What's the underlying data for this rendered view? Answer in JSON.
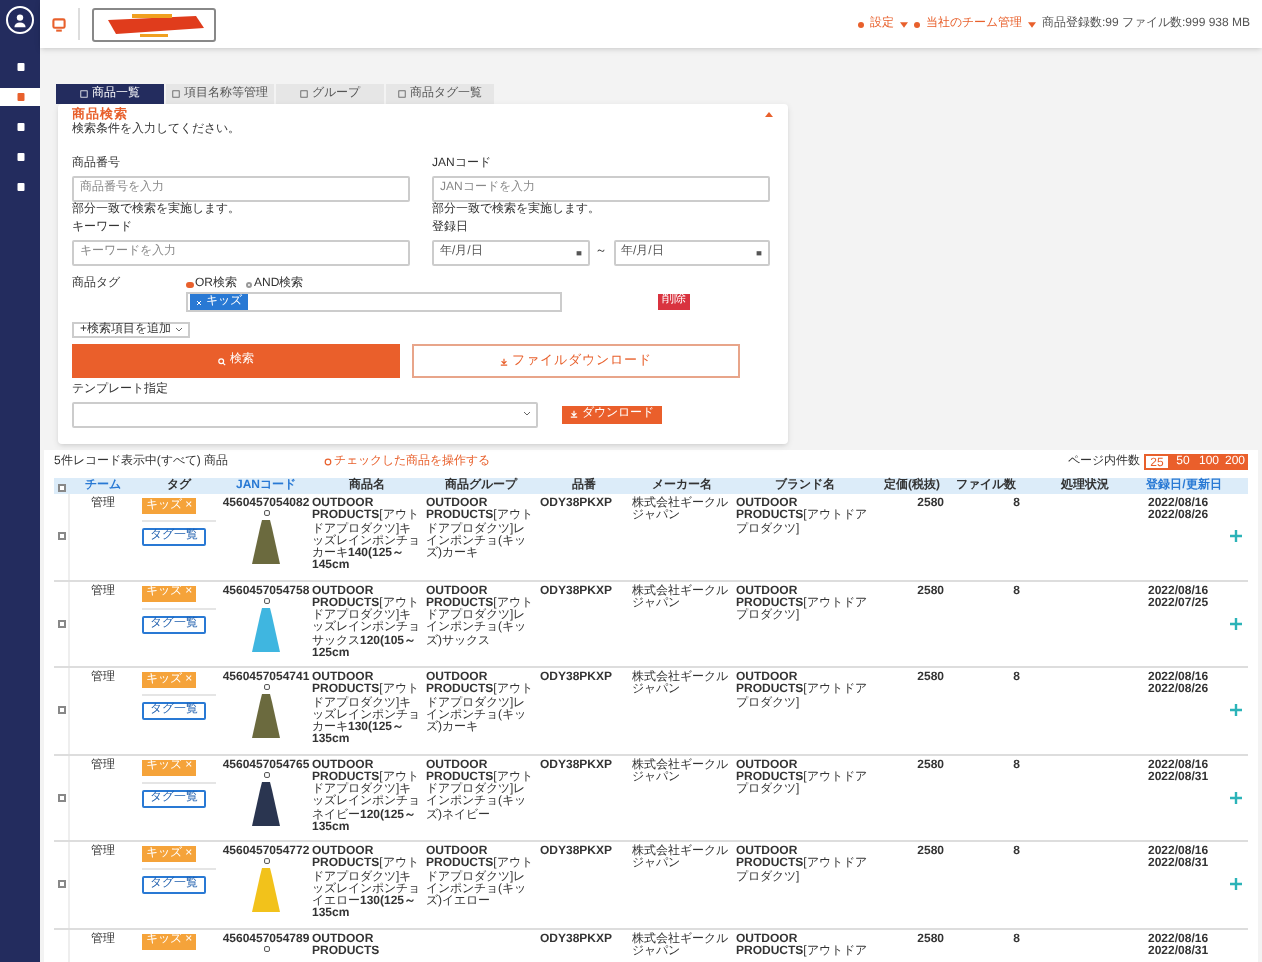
{
  "sidebar": {
    "items": [
      {
        "selected": false
      },
      {
        "selected": true
      },
      {
        "selected": false
      },
      {
        "selected": false
      },
      {
        "selected": false
      }
    ]
  },
  "header": {
    "settings": "設定",
    "team": "当社のチーム管理",
    "stats": "商品登録数:99 ファイル数:999 938 MB"
  },
  "tabs": [
    {
      "label": "商品一覧",
      "selected": true
    },
    {
      "label": "項目名称等管理",
      "selected": false
    },
    {
      "label": "グループ",
      "selected": false
    },
    {
      "label": "商品タグ一覧",
      "selected": false
    }
  ],
  "search": {
    "title": "商品検索",
    "subtitle": "検索条件を入力してください。",
    "product_no": {
      "label": "商品番号",
      "placeholder": "商品番号を入力",
      "hint": "部分一致で検索を実施します。"
    },
    "jan": {
      "label": "JANコード",
      "placeholder": "JANコードを入力",
      "hint": "部分一致で検索を実施します。"
    },
    "keyword": {
      "label": "キーワード",
      "placeholder": "キーワードを入力"
    },
    "date": {
      "label": "登録日",
      "from": "年/月/日",
      "separator": "～",
      "to": "年/月/日"
    },
    "tag": {
      "label": "商品タグ",
      "modes": [
        {
          "label": "OR検索",
          "selected": true
        },
        {
          "label": "AND検索",
          "selected": false
        }
      ],
      "chips": [
        "キッズ"
      ],
      "delete": "削除"
    },
    "add_condition": "+検索項目を追加",
    "search_button": "検索",
    "file_download": "ファイルダウンロード",
    "template_label": "テンプレート指定",
    "download_button": "ダウンロード"
  },
  "results": {
    "count": "5件レコード表示中(すべて) 商品",
    "bulk_action": "チェックした商品を操作する",
    "page_size_label": "ページ内件数",
    "page_sizes": [
      {
        "label": "25",
        "selected": true
      },
      {
        "label": "50",
        "selected": false
      },
      {
        "label": "100",
        "selected": false
      },
      {
        "label": "200",
        "selected": false
      }
    ]
  },
  "table": {
    "select_all_checked": false,
    "columns": [
      "チーム",
      "タグ",
      "JANコード",
      "商品名",
      "商品グループ",
      "品番",
      "メーカー名",
      "ブランド名",
      "定価(税抜)",
      "ファイル数",
      "処理状況",
      "登録日/更新日"
    ],
    "rows": [
      {
        "checked": false,
        "team": "管理",
        "tag": "キッズ ×",
        "tag_list": "タグ一覧",
        "jan": "4560457054082",
        "color": "#6b6a3e",
        "name": "**OUTDOOR PRODUCTS**[アウトドアプロダクツ]キッズレインポンチョカーキ**140(125～145cm**",
        "group": "**OUTDOOR PRODUCTS**[アウトドアプロダクツ]レインポンチョ(キッズ)カーキ",
        "part_no": "ODY38PKXP",
        "maker": "株式会社ギークルジャパン",
        "brand": "**OUTDOOR PRODUCTS**[アウトドアプロダクツ]",
        "price": "2580",
        "files": "8",
        "registered": "2022/08/16",
        "updated": "2022/08/26"
      },
      {
        "checked": false,
        "team": "管理",
        "tag": "キッズ ×",
        "tag_list": "タグ一覧",
        "jan": "4560457054758",
        "color": "#3fb6e0",
        "name": "**OUTDOOR PRODUCTS**[アウトドアプロダクツ]キッズレインポンチョサックス**120(105～125cm**",
        "group": "**OUTDOOR PRODUCTS**[アウトドアプロダクツ]レインポンチョ(キッズ)サックス",
        "part_no": "ODY38PKXP",
        "maker": "株式会社ギークルジャパン",
        "brand": "**OUTDOOR PRODUCTS**[アウトドアプロダクツ]",
        "price": "2580",
        "files": "8",
        "registered": "2022/08/16",
        "updated": "2022/07/25"
      },
      {
        "checked": false,
        "team": "管理",
        "tag": "キッズ ×",
        "tag_list": "タグ一覧",
        "jan": "4560457054741",
        "color": "#6b6a3e",
        "name": "**OUTDOOR PRODUCTS**[アウトドアプロダクツ]キッズレインポンチョカーキ**130(125～135cm**",
        "group": "**OUTDOOR PRODUCTS**[アウトドアプロダクツ]レインポンチョ(キッズ)カーキ",
        "part_no": "ODY38PKXP",
        "maker": "株式会社ギークルジャパン",
        "brand": "**OUTDOOR PRODUCTS**[アウトドアプロダクツ]",
        "price": "2580",
        "files": "8",
        "registered": "2022/08/16",
        "updated": "2022/08/26"
      },
      {
        "checked": false,
        "team": "管理",
        "tag": "キッズ ×",
        "tag_list": "タグ一覧",
        "jan": "4560457054765",
        "color": "#2a3550",
        "name": "**OUTDOOR PRODUCTS**[アウトドアプロダクツ]キッズレインポンチョネイビー**120(125～135cm**",
        "group": "**OUTDOOR PRODUCTS**[アウトドアプロダクツ]レインポンチョ(キッズ)ネイビー",
        "part_no": "ODY38PKXP",
        "maker": "株式会社ギークルジャパン",
        "brand": "**OUTDOOR PRODUCTS**[アウトドアプロダクツ]",
        "price": "2580",
        "files": "8",
        "registered": "2022/08/16",
        "updated": "2022/08/31"
      },
      {
        "checked": false,
        "team": "管理",
        "tag": "キッズ ×",
        "tag_list": "タグ一覧",
        "jan": "4560457054772",
        "color": "#f2c21b",
        "name": "**OUTDOOR PRODUCTS**[アウトドアプロダクツ]キッズレインポンチョイエロー**130(125～135cm**",
        "group": "**OUTDOOR PRODUCTS**[アウトドアプロダクツ]レインポンチョ(キッズ)イエロー",
        "part_no": "ODY38PKXP",
        "maker": "株式会社ギークルジャパン",
        "brand": "**OUTDOOR PRODUCTS**[アウトドアプロダクツ]",
        "price": "2580",
        "files": "8",
        "registered": "2022/08/16",
        "updated": "2022/08/31"
      },
      {
        "team": "管理",
        "tag": "キッズ ×",
        "jan": "4560457054789",
        "name": "**OUTDOOR PRODUCTS**",
        "part_no": "ODY38PKXP",
        "maker": "株式会社ギークルジャパン",
        "brand": "**OUTDOOR PRODUCTS**[アウトドア",
        "price": "2580",
        "files": "8",
        "registered": "2022/08/16",
        "updated": "2022/08/31"
      }
    ]
  }
}
